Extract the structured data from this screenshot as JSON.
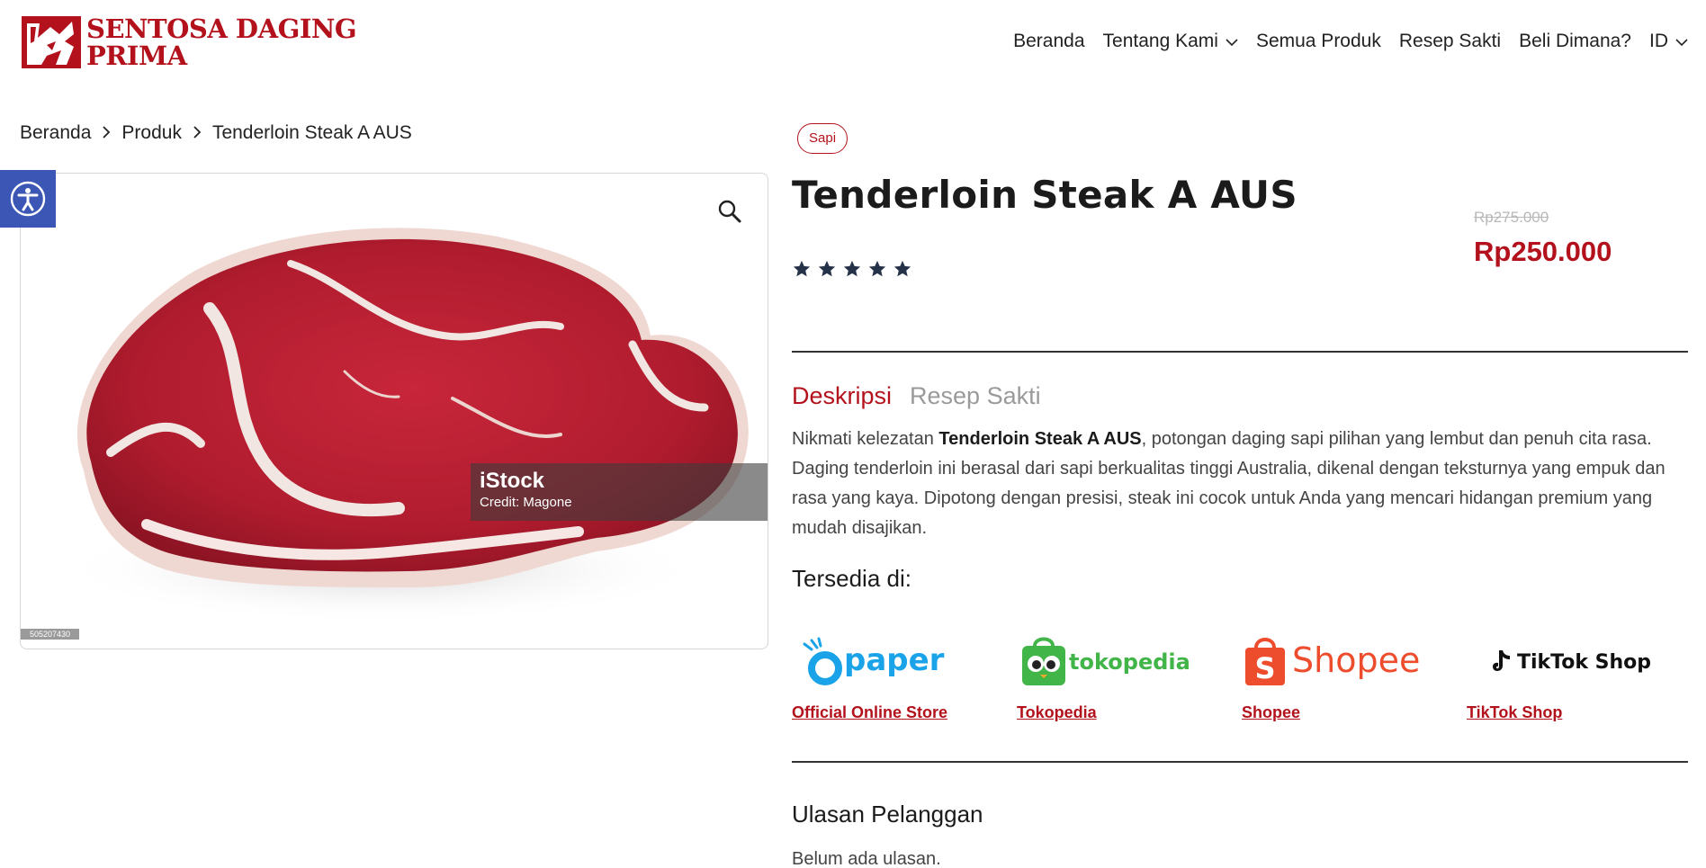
{
  "brand": {
    "line1": "SENTOSA DAGING",
    "line2": "PRIMA",
    "color": "#b3121c"
  },
  "nav": {
    "items": [
      "Beranda",
      "Tentang Kami",
      "Semua Produk",
      "Resep Sakti",
      "Beli Dimana?",
      "ID"
    ],
    "dropdown_items": [
      1,
      5
    ]
  },
  "breadcrumb": {
    "items": [
      "Beranda",
      "Produk",
      "Tenderloin Steak A AUS"
    ]
  },
  "product": {
    "category_tag": "Sapi",
    "title": "Tenderloin Steak A AUS",
    "old_price": "Rp275.000",
    "price": "Rp250.000",
    "rating_stars": 5,
    "image": {
      "watermark_brand": "iStock",
      "watermark_credit": "Credit: Magone",
      "image_id": "505207430"
    }
  },
  "tabs": {
    "active": "Deskripsi",
    "inactive": "Resep Sakti"
  },
  "description": {
    "intro": "Nikmati kelezatan ",
    "bold": "Tenderloin Steak A AUS",
    "rest": ", potongan daging sapi pilihan yang lembut dan penuh cita rasa. Daging tenderloin ini berasal dari sapi berkualitas tinggi Australia, dikenal dengan teksturnya yang empuk dan rasa yang kaya. Dipotong dengan presisi, steak ini cocok untuk Anda yang mencari hidangan premium yang mudah disajikan."
  },
  "availability": {
    "title": "Tersedia di:",
    "stores": [
      {
        "logo": "paper",
        "link": "Official Online Store"
      },
      {
        "logo": "tokopedia",
        "link": "Tokopedia"
      },
      {
        "logo": "Shopee",
        "link": "Shopee"
      },
      {
        "logo": "TikTok Shop",
        "link": "TikTok Shop"
      }
    ]
  },
  "reviews": {
    "title": "Ulasan Pelanggan",
    "empty": "Belum ada ulasan."
  },
  "colors": {
    "accent": "#b3121c",
    "a11y": "#3b56b4",
    "text": "#222222"
  }
}
